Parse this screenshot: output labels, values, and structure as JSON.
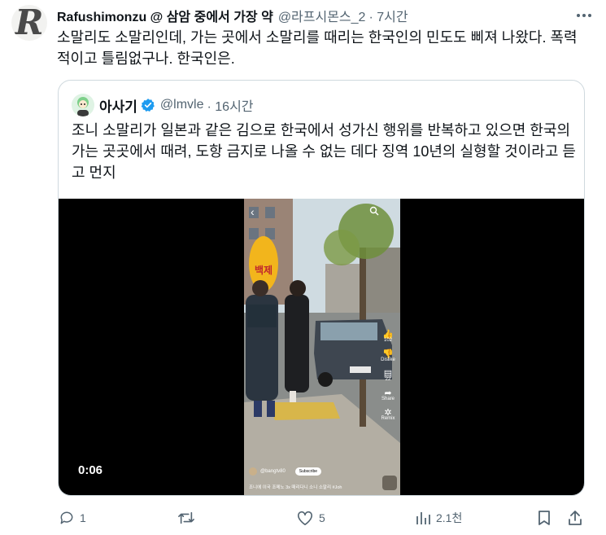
{
  "tweet": {
    "author_name": "Rafushimonzu @ 삼암 중에서 가장 약",
    "author_handle": "@라프시몬스_2",
    "time": "· 7시간",
    "text": "소말리도 소말리인데, 가는 곳에서 소말리를 때리는 한국인의 민도도 삐져 나왔다. 폭력적이고 틀림없구나. 한국인은.",
    "avatar_letter": "R"
  },
  "quote": {
    "author_name": "아사기",
    "author_handle": "@lmvle",
    "time": "· 16시간",
    "text": "조니 소말리가 일본과 같은 김으로 한국에서 성가신 행위를 반복하고 있으면 한국의 가는 곳곳에서 때려, 도항 금지로 나올 수 없는 데다 징역 10년의 실형할 것이라고 듣고 먼지",
    "video": {
      "timecode": "0:06",
      "sign_text": "백제",
      "overlay_counts": [
        "102",
        "Dislike",
        "22",
        "Share",
        "Remix"
      ],
      "channel": "@bangtv80",
      "subscribe": "Subscribe",
      "caption": "조니에 이국 조메노 3x 때리다니 소니 소말리 #Joh"
    }
  },
  "actions": {
    "replies": "1",
    "retweets": "",
    "likes": "5",
    "views": "2.1천"
  },
  "colors": {
    "text": "#0f1419",
    "secondary": "#536471",
    "border": "#cfd9de",
    "verified": "#1d9bf0"
  }
}
